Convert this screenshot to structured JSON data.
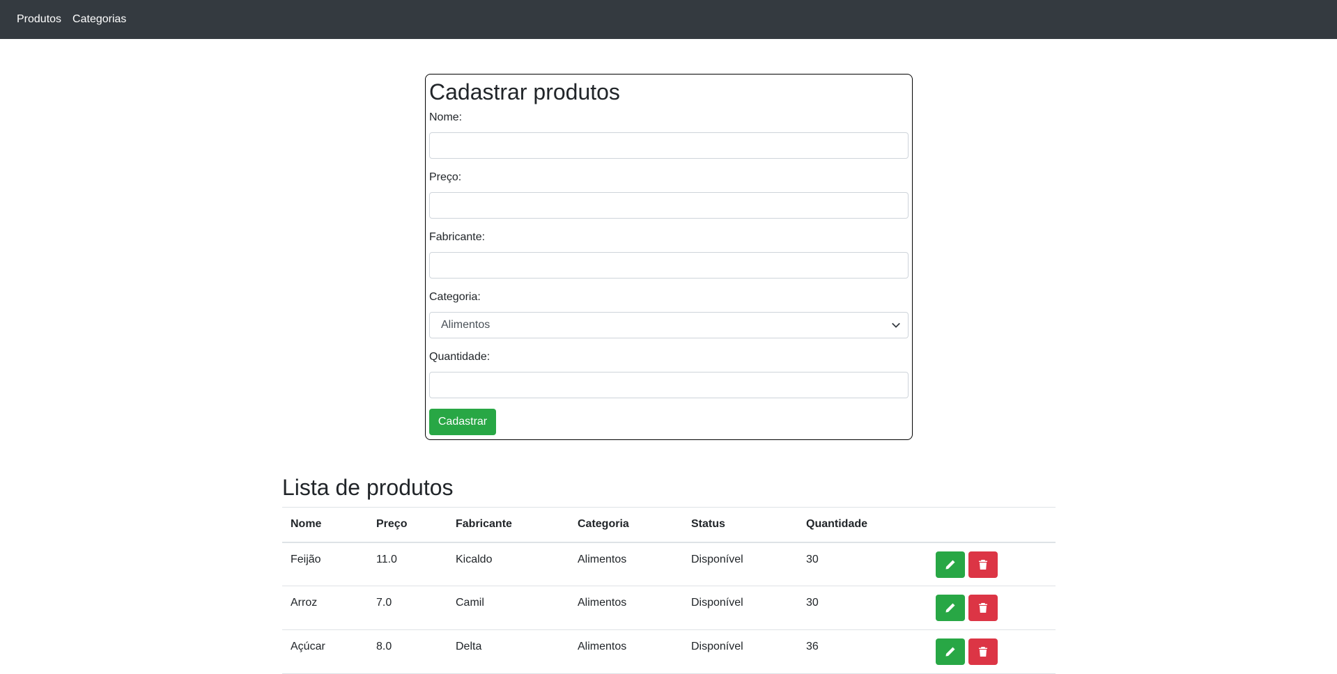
{
  "nav": {
    "items": [
      {
        "label": "Produtos"
      },
      {
        "label": "Categorias"
      }
    ]
  },
  "form": {
    "title": "Cadastrar produtos",
    "fields": {
      "nome": {
        "label": "Nome:",
        "value": ""
      },
      "preco": {
        "label": "Preço:",
        "value": ""
      },
      "fabricante": {
        "label": "Fabricante:",
        "value": ""
      },
      "categoria": {
        "label": "Categoria:",
        "selected": "Alimentos"
      },
      "quantidade": {
        "label": "Quantidade:",
        "value": ""
      }
    },
    "submit_label": "Cadastrar"
  },
  "list": {
    "title": "Lista de produtos",
    "columns": [
      "Nome",
      "Preço",
      "Fabricante",
      "Categoria",
      "Status",
      "Quantidade",
      ""
    ],
    "rows": [
      {
        "nome": "Feijão",
        "preco": "11.0",
        "fabricante": "Kicaldo",
        "categoria": "Alimentos",
        "status": "Disponível",
        "quantidade": "30"
      },
      {
        "nome": "Arroz",
        "preco": "7.0",
        "fabricante": "Camil",
        "categoria": "Alimentos",
        "status": "Disponível",
        "quantidade": "30"
      },
      {
        "nome": "Açúcar",
        "preco": "8.0",
        "fabricante": "Delta",
        "categoria": "Alimentos",
        "status": "Disponível",
        "quantidade": "36"
      }
    ],
    "row_actions": {
      "edit_icon": "pencil-icon",
      "delete_icon": "trash-icon"
    }
  },
  "colors": {
    "navbar": "#343a40",
    "success": "#28a745",
    "danger": "#dc3545"
  }
}
